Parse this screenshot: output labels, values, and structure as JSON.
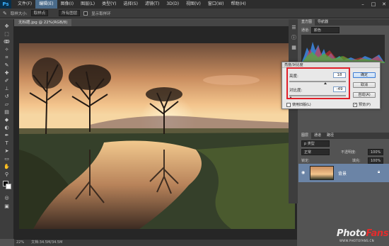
{
  "app": {
    "logo": "Ps",
    "menu": [
      "文件(F)",
      "编辑(E)",
      "图像(I)",
      "图层(L)",
      "类型(Y)",
      "选择(S)",
      "滤镜(T)",
      "3D(D)",
      "视图(V)",
      "窗口(W)",
      "帮助(H)"
    ],
    "active_menu_index": 1
  },
  "options_bar": {
    "sample_size_label": "取样大小:",
    "sample_size_value": "取样点",
    "sample_layer_value": "所有图层",
    "show_ring_label": "显示取样环"
  },
  "document": {
    "tab_title": "无标题.jpg @ 22%(RGB/8)"
  },
  "status": {
    "zoom": "22%",
    "doc_info": "文档:34.5M/34.5M"
  },
  "panels": {
    "top_tabs": [
      "直方图",
      "导航器"
    ],
    "channel_label": "通道:",
    "channel_value": "颜色",
    "layers_tabs": [
      "图层",
      "通道",
      "路径"
    ],
    "kind_label": "p 类型",
    "blend_mode": "正常",
    "opacity_label": "不透明度:",
    "opacity_value": "100%",
    "lock_label": "锁定:",
    "fill_label": "填充:",
    "fill_value": "100%",
    "layer_name": "背景"
  },
  "dialog": {
    "title": "亮度/对比度",
    "brightness_label": "亮度:",
    "brightness_value": "18",
    "contrast_label": "对比度:",
    "contrast_value": "-49",
    "ok_label": "确定",
    "cancel_label": "取消",
    "auto_label": "自动(A)",
    "legacy_label": "使用旧版(L)",
    "preview_label": "预览(P)",
    "preview_checked": true,
    "legacy_checked": false
  },
  "watermark": {
    "text_a": "Photo",
    "text_b": "Fans",
    "url": "WWW.PHOTOFANS.CN"
  },
  "colors": {
    "accent": "#e0202a",
    "highlight_menu": "#4a6b8a"
  }
}
